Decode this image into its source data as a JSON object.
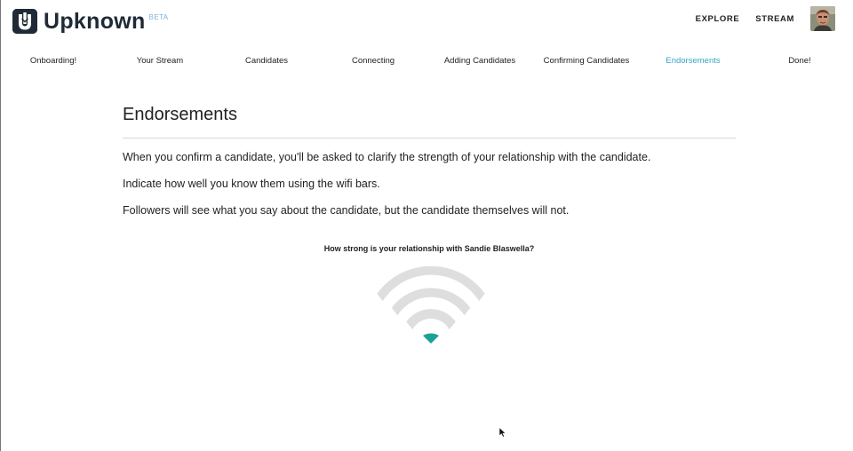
{
  "brand": {
    "name": "Upknown",
    "badge": "BETA",
    "dark_color": "#1f2a36"
  },
  "header": {
    "links": [
      {
        "label": "EXPLORE"
      },
      {
        "label": "STREAM"
      }
    ]
  },
  "steps": [
    {
      "label": "Onboarding!"
    },
    {
      "label": "Your Stream"
    },
    {
      "label": "Candidates"
    },
    {
      "label": "Connecting"
    },
    {
      "label": "Adding Candidates"
    },
    {
      "label": "Confirming Candidates"
    },
    {
      "label": "Endorsements",
      "active": true
    },
    {
      "label": "Done!"
    }
  ],
  "main": {
    "title": "Endorsements",
    "paragraphs": [
      "When you confirm a candidate, you'll be asked to clarify the strength of your relationship with the candidate.",
      "Indicate how well you know them using the wifi bars.",
      "Followers will see what you say about the candidate, but the candidate themselves will not."
    ]
  },
  "relationship": {
    "question": "How strong is your relationship with Sandie Blaswella?",
    "selected_level": 1,
    "max_level": 4,
    "active_color": "#1aa394",
    "inactive_color": "#dedede"
  },
  "colors": {
    "accent": "#3aa3c6",
    "text": "#222222"
  }
}
